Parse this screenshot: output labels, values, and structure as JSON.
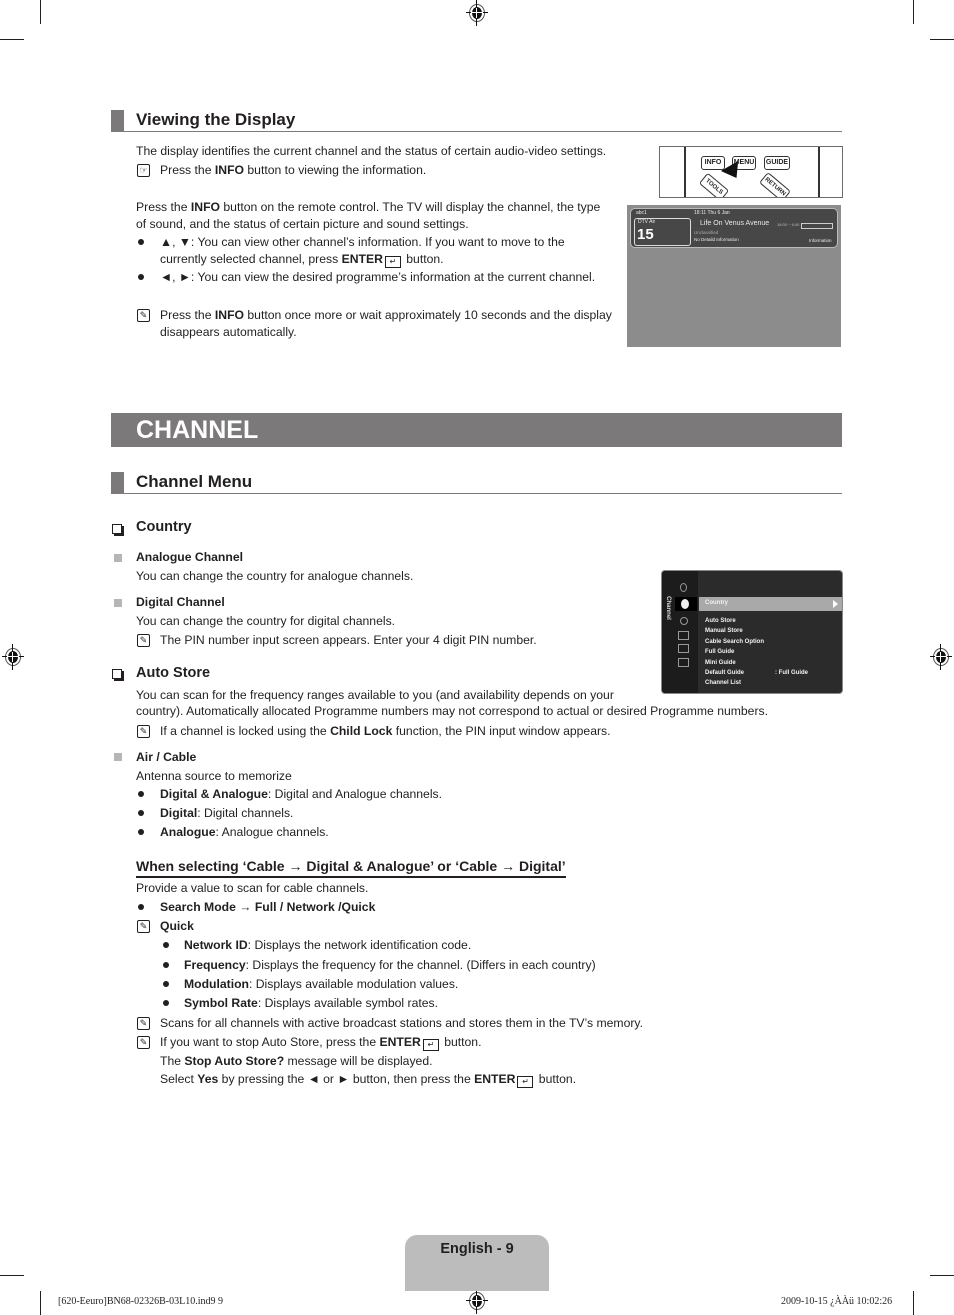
{
  "viewing_display": {
    "title": "Viewing the Display",
    "intro": "The display identifies the current channel and the status of certain audio-video settings.",
    "remote_note_pre": "Press the ",
    "remote_note_bold": "INFO",
    "remote_note_post": " button to viewing the information.",
    "para1_line1_pre": "Press the ",
    "para1_line1_bold": "INFO",
    "para1_line1_post": " button on the remote control. The TV will display the channel, the type",
    "para1_line2": "of sound, and the status of certain picture and sound settings.",
    "bullet1_line1": "▲, ▼: You can view other channel’s information. If you want to move to the",
    "bullet1_line2_pre": "currently selected channel, press ",
    "bullet1_line2_bold": "ENTER",
    "bullet1_line2_post": " button.",
    "bullet2": "◄, ►: You can view the desired programme’s information at the current channel.",
    "note2_line1_pre": "Press the ",
    "note2_line1_bold": "INFO",
    "note2_line1_post": " button once more or wait approximately 10 seconds and the display",
    "note2_line2": "disappears automatically.",
    "remote": {
      "buttons": [
        "INFO",
        "MENU",
        "GUIDE",
        "TOOLS",
        "RETURN"
      ]
    },
    "osd": {
      "channel_name": "abc1",
      "source": "DTV Air",
      "channel_number": "15",
      "datetime": "18:11 Thu 6 Jan",
      "programme": "Life On Venus Avenue",
      "rating": "Unclassified",
      "details": "No Detaild Information",
      "time_range": "18:00 ~ 6:00",
      "info_label": "Information"
    }
  },
  "chapter": {
    "title": "CHANNEL"
  },
  "channel_menu": {
    "title": "Channel Menu",
    "country": {
      "heading": "Country",
      "analogue_heading": "Analogue Channel",
      "analogue_text": "You can change the country for analogue channels.",
      "digital_heading": "Digital Channel",
      "digital_text": "You can change the country for digital channels.",
      "digital_note": "The PIN number input screen appears. Enter your 4 digit PIN number."
    },
    "osd_menu": {
      "side_label": "Channel",
      "selected": "Country",
      "items": [
        "Auto Store",
        "Manual Store",
        "Cable Search Option",
        "Full Guide",
        "Mini Guide",
        "Default Guide",
        "Channel List"
      ],
      "default_guide_value": ": Full Guide"
    },
    "auto_store": {
      "heading": "Auto Store",
      "line1": "You can scan for the frequency ranges available to you (and availability depends on your",
      "line2": "country). Automatically allocated Programme numbers may not correspond to actual or desired Programme numbers.",
      "note_pre": "If a channel is locked using the ",
      "note_bold": "Child Lock",
      "note_post": " function, the PIN input window appears."
    },
    "air_cable": {
      "heading": "Air / Cable",
      "text": "Antenna source to memorize",
      "options": [
        {
          "bold": "Digital & Analogue",
          "text": ": Digital and Analogue channels."
        },
        {
          "bold": "Digital",
          "text": ": Digital channels."
        },
        {
          "bold": "Analogue",
          "text": ": Analogue channels."
        }
      ]
    },
    "cable": {
      "heading": "When selecting ‘Cable → Digital & Analogue’ or ‘Cable → Digital’",
      "intro": "Provide a value to scan for cable channels.",
      "search_mode": "Search Mode → Full / Network /Quick",
      "quick": "Quick",
      "quick_items": [
        {
          "bold": "Network ID",
          "text": ": Displays the network identification code."
        },
        {
          "bold": "Frequency",
          "text": ": Displays the frequency for the channel. (Differs in each country)"
        },
        {
          "bold": "Modulation",
          "text": ": Displays available modulation values."
        },
        {
          "bold": "Symbol Rate",
          "text": ": Displays available symbol rates."
        }
      ],
      "note_scan": "Scans for all channels with active broadcast stations and stores them in the TV’s memory.",
      "note_stop_pre": "If you want to stop Auto Store, press the ",
      "note_stop_bold": "ENTER",
      "note_stop_post": " button.",
      "msg_pre": "The ",
      "msg_bold": "Stop Auto Store?",
      "msg_post": " message will be displayed.",
      "select_pre": "Select ",
      "select_bold1": "Yes",
      "select_mid": " by pressing the ◄ or ► button, then press the ",
      "select_bold2": "ENTER",
      "select_post": " button."
    }
  },
  "page_label": "English - 9",
  "footer": {
    "left": "[620-Eeuro]BN68-02326B-03L10.ind9   9",
    "right": "2009-10-15   ¿ÀÀü 10:02:26"
  },
  "icons": {
    "enter": "↵",
    "note": "✎",
    "remote_note": "☞"
  }
}
